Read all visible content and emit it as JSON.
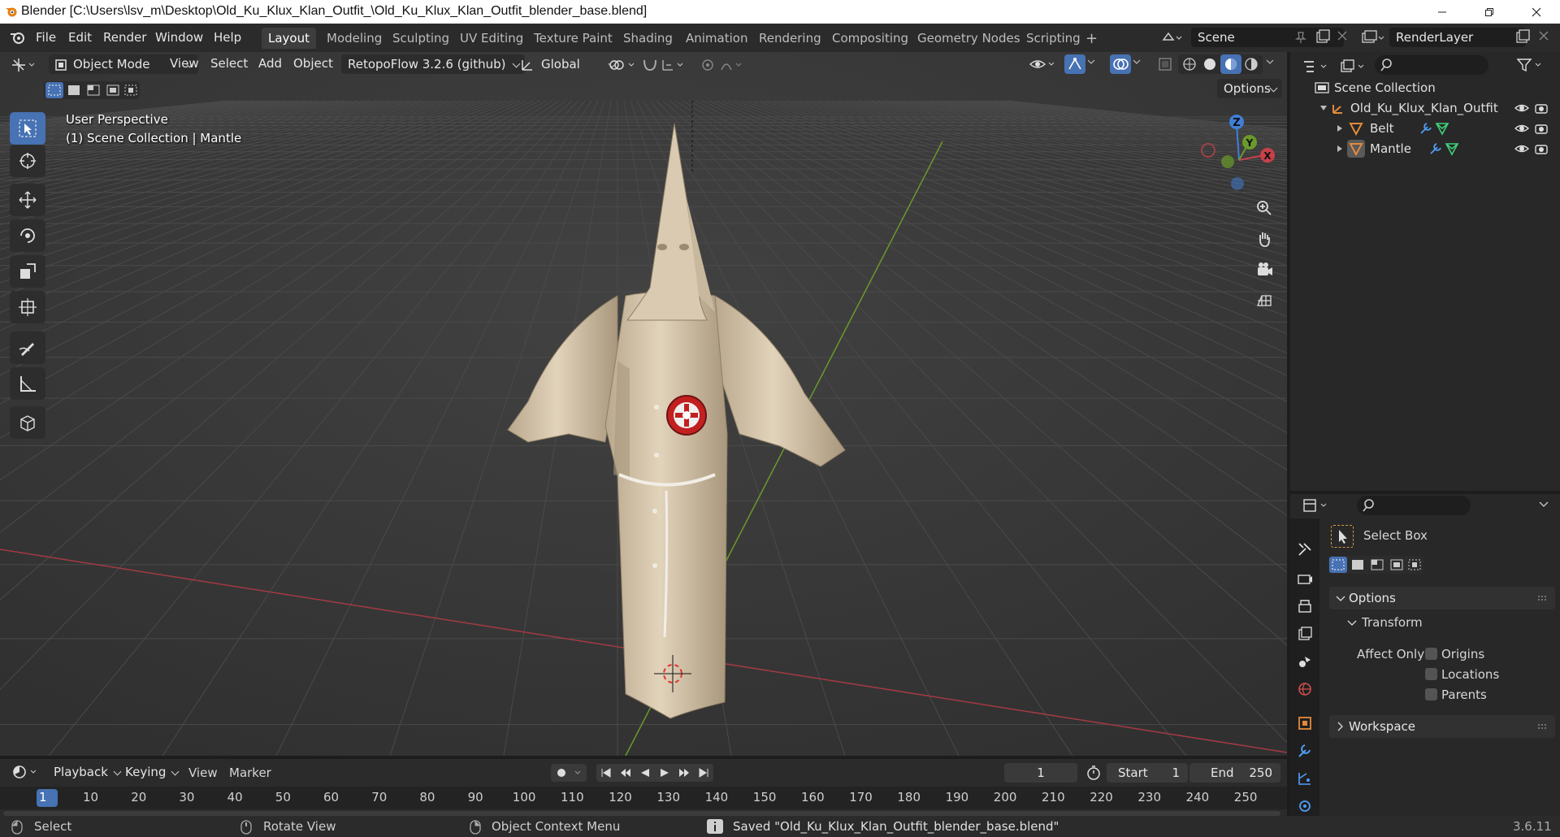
{
  "app": {
    "window_title": "Blender [C:\\Users\\lsv_m\\Desktop\\Old_Ku_Klux_Klan_Outfit_\\Old_Ku_Klux_Klan_Outfit_blender_base.blend]",
    "version": "3.6.11"
  },
  "menu": [
    "File",
    "Edit",
    "Render",
    "Window",
    "Help"
  ],
  "workspaces": [
    "Layout",
    "Modeling",
    "Sculpting",
    "UV Editing",
    "Texture Paint",
    "Shading",
    "Animation",
    "Rendering",
    "Compositing",
    "Geometry Nodes",
    "Scripting"
  ],
  "active_workspace": "Layout",
  "scene": {
    "name": "Scene",
    "render_layer": "RenderLayer"
  },
  "viewport_header": {
    "mode": "Object Mode",
    "menus": [
      "View",
      "Select",
      "Add",
      "Object"
    ],
    "addon": "RetopoFlow 3.2.6 (github)",
    "orientation": "Global",
    "options": "Options"
  },
  "viewport": {
    "perspective_label": "User Perspective",
    "collection_label": "(1) Scene Collection | Mantle",
    "gizmo_axes": {
      "x": "X",
      "y": "Y",
      "z": "Z"
    }
  },
  "outliner": {
    "root": "Scene Collection",
    "collection": "Old_Ku_Klux_Klan_Outfit",
    "objects": [
      "Belt",
      "Mantle"
    ]
  },
  "properties": {
    "tool_name": "Select Box",
    "options_panel": "Options",
    "transform_panel": "Transform",
    "affect_only_label": "Affect Only",
    "checkboxes": [
      "Origins",
      "Locations",
      "Parents"
    ],
    "workspace_panel": "Workspace"
  },
  "timeline": {
    "menus": [
      "Playback",
      "Keying",
      "View",
      "Marker"
    ],
    "current_frame": "1",
    "start_label": "Start",
    "start": "1",
    "end_label": "End",
    "end": "250",
    "ruler": [
      "1",
      "10",
      "20",
      "30",
      "40",
      "50",
      "60",
      "70",
      "80",
      "90",
      "100",
      "110",
      "120",
      "130",
      "140",
      "150",
      "160",
      "170",
      "180",
      "190",
      "200",
      "210",
      "220",
      "230",
      "240",
      "250"
    ]
  },
  "status_bar": {
    "select": "Select",
    "rotate": "Rotate View",
    "context": "Object Context Menu",
    "message": "Saved \"Old_Ku_Klux_Klan_Outfit_blender_base.blend\""
  },
  "colors": {
    "accent": "#4772b3",
    "axis_x": "#c9404a",
    "axis_y": "#6a9a2a",
    "axis_z": "#3f7fd9"
  }
}
